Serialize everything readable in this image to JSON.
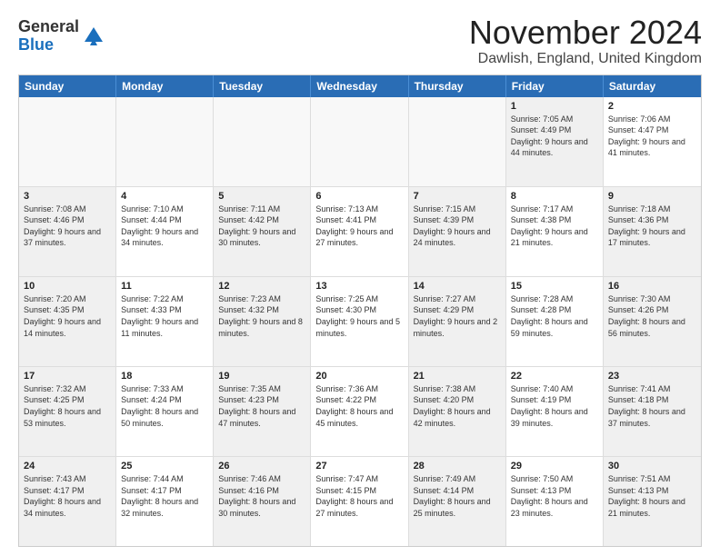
{
  "logo": {
    "general": "General",
    "blue": "Blue"
  },
  "title": "November 2024",
  "subtitle": "Dawlish, England, United Kingdom",
  "headers": [
    "Sunday",
    "Monday",
    "Tuesday",
    "Wednesday",
    "Thursday",
    "Friday",
    "Saturday"
  ],
  "rows": [
    [
      {
        "day": "",
        "text": "",
        "empty": true
      },
      {
        "day": "",
        "text": "",
        "empty": true
      },
      {
        "day": "",
        "text": "",
        "empty": true
      },
      {
        "day": "",
        "text": "",
        "empty": true
      },
      {
        "day": "",
        "text": "",
        "empty": true
      },
      {
        "day": "1",
        "text": "Sunrise: 7:05 AM\nSunset: 4:49 PM\nDaylight: 9 hours and 44 minutes.",
        "shaded": true
      },
      {
        "day": "2",
        "text": "Sunrise: 7:06 AM\nSunset: 4:47 PM\nDaylight: 9 hours and 41 minutes.",
        "shaded": false
      }
    ],
    [
      {
        "day": "3",
        "text": "Sunrise: 7:08 AM\nSunset: 4:46 PM\nDaylight: 9 hours and 37 minutes.",
        "shaded": true
      },
      {
        "day": "4",
        "text": "Sunrise: 7:10 AM\nSunset: 4:44 PM\nDaylight: 9 hours and 34 minutes.",
        "shaded": false
      },
      {
        "day": "5",
        "text": "Sunrise: 7:11 AM\nSunset: 4:42 PM\nDaylight: 9 hours and 30 minutes.",
        "shaded": true
      },
      {
        "day": "6",
        "text": "Sunrise: 7:13 AM\nSunset: 4:41 PM\nDaylight: 9 hours and 27 minutes.",
        "shaded": false
      },
      {
        "day": "7",
        "text": "Sunrise: 7:15 AM\nSunset: 4:39 PM\nDaylight: 9 hours and 24 minutes.",
        "shaded": true
      },
      {
        "day": "8",
        "text": "Sunrise: 7:17 AM\nSunset: 4:38 PM\nDaylight: 9 hours and 21 minutes.",
        "shaded": false
      },
      {
        "day": "9",
        "text": "Sunrise: 7:18 AM\nSunset: 4:36 PM\nDaylight: 9 hours and 17 minutes.",
        "shaded": true
      }
    ],
    [
      {
        "day": "10",
        "text": "Sunrise: 7:20 AM\nSunset: 4:35 PM\nDaylight: 9 hours and 14 minutes.",
        "shaded": true
      },
      {
        "day": "11",
        "text": "Sunrise: 7:22 AM\nSunset: 4:33 PM\nDaylight: 9 hours and 11 minutes.",
        "shaded": false
      },
      {
        "day": "12",
        "text": "Sunrise: 7:23 AM\nSunset: 4:32 PM\nDaylight: 9 hours and 8 minutes.",
        "shaded": true
      },
      {
        "day": "13",
        "text": "Sunrise: 7:25 AM\nSunset: 4:30 PM\nDaylight: 9 hours and 5 minutes.",
        "shaded": false
      },
      {
        "day": "14",
        "text": "Sunrise: 7:27 AM\nSunset: 4:29 PM\nDaylight: 9 hours and 2 minutes.",
        "shaded": true
      },
      {
        "day": "15",
        "text": "Sunrise: 7:28 AM\nSunset: 4:28 PM\nDaylight: 8 hours and 59 minutes.",
        "shaded": false
      },
      {
        "day": "16",
        "text": "Sunrise: 7:30 AM\nSunset: 4:26 PM\nDaylight: 8 hours and 56 minutes.",
        "shaded": true
      }
    ],
    [
      {
        "day": "17",
        "text": "Sunrise: 7:32 AM\nSunset: 4:25 PM\nDaylight: 8 hours and 53 minutes.",
        "shaded": true
      },
      {
        "day": "18",
        "text": "Sunrise: 7:33 AM\nSunset: 4:24 PM\nDaylight: 8 hours and 50 minutes.",
        "shaded": false
      },
      {
        "day": "19",
        "text": "Sunrise: 7:35 AM\nSunset: 4:23 PM\nDaylight: 8 hours and 47 minutes.",
        "shaded": true
      },
      {
        "day": "20",
        "text": "Sunrise: 7:36 AM\nSunset: 4:22 PM\nDaylight: 8 hours and 45 minutes.",
        "shaded": false
      },
      {
        "day": "21",
        "text": "Sunrise: 7:38 AM\nSunset: 4:20 PM\nDaylight: 8 hours and 42 minutes.",
        "shaded": true
      },
      {
        "day": "22",
        "text": "Sunrise: 7:40 AM\nSunset: 4:19 PM\nDaylight: 8 hours and 39 minutes.",
        "shaded": false
      },
      {
        "day": "23",
        "text": "Sunrise: 7:41 AM\nSunset: 4:18 PM\nDaylight: 8 hours and 37 minutes.",
        "shaded": true
      }
    ],
    [
      {
        "day": "24",
        "text": "Sunrise: 7:43 AM\nSunset: 4:17 PM\nDaylight: 8 hours and 34 minutes.",
        "shaded": true
      },
      {
        "day": "25",
        "text": "Sunrise: 7:44 AM\nSunset: 4:17 PM\nDaylight: 8 hours and 32 minutes.",
        "shaded": false
      },
      {
        "day": "26",
        "text": "Sunrise: 7:46 AM\nSunset: 4:16 PM\nDaylight: 8 hours and 30 minutes.",
        "shaded": true
      },
      {
        "day": "27",
        "text": "Sunrise: 7:47 AM\nSunset: 4:15 PM\nDaylight: 8 hours and 27 minutes.",
        "shaded": false
      },
      {
        "day": "28",
        "text": "Sunrise: 7:49 AM\nSunset: 4:14 PM\nDaylight: 8 hours and 25 minutes.",
        "shaded": true
      },
      {
        "day": "29",
        "text": "Sunrise: 7:50 AM\nSunset: 4:13 PM\nDaylight: 8 hours and 23 minutes.",
        "shaded": false
      },
      {
        "day": "30",
        "text": "Sunrise: 7:51 AM\nSunset: 4:13 PM\nDaylight: 8 hours and 21 minutes.",
        "shaded": true
      }
    ]
  ]
}
